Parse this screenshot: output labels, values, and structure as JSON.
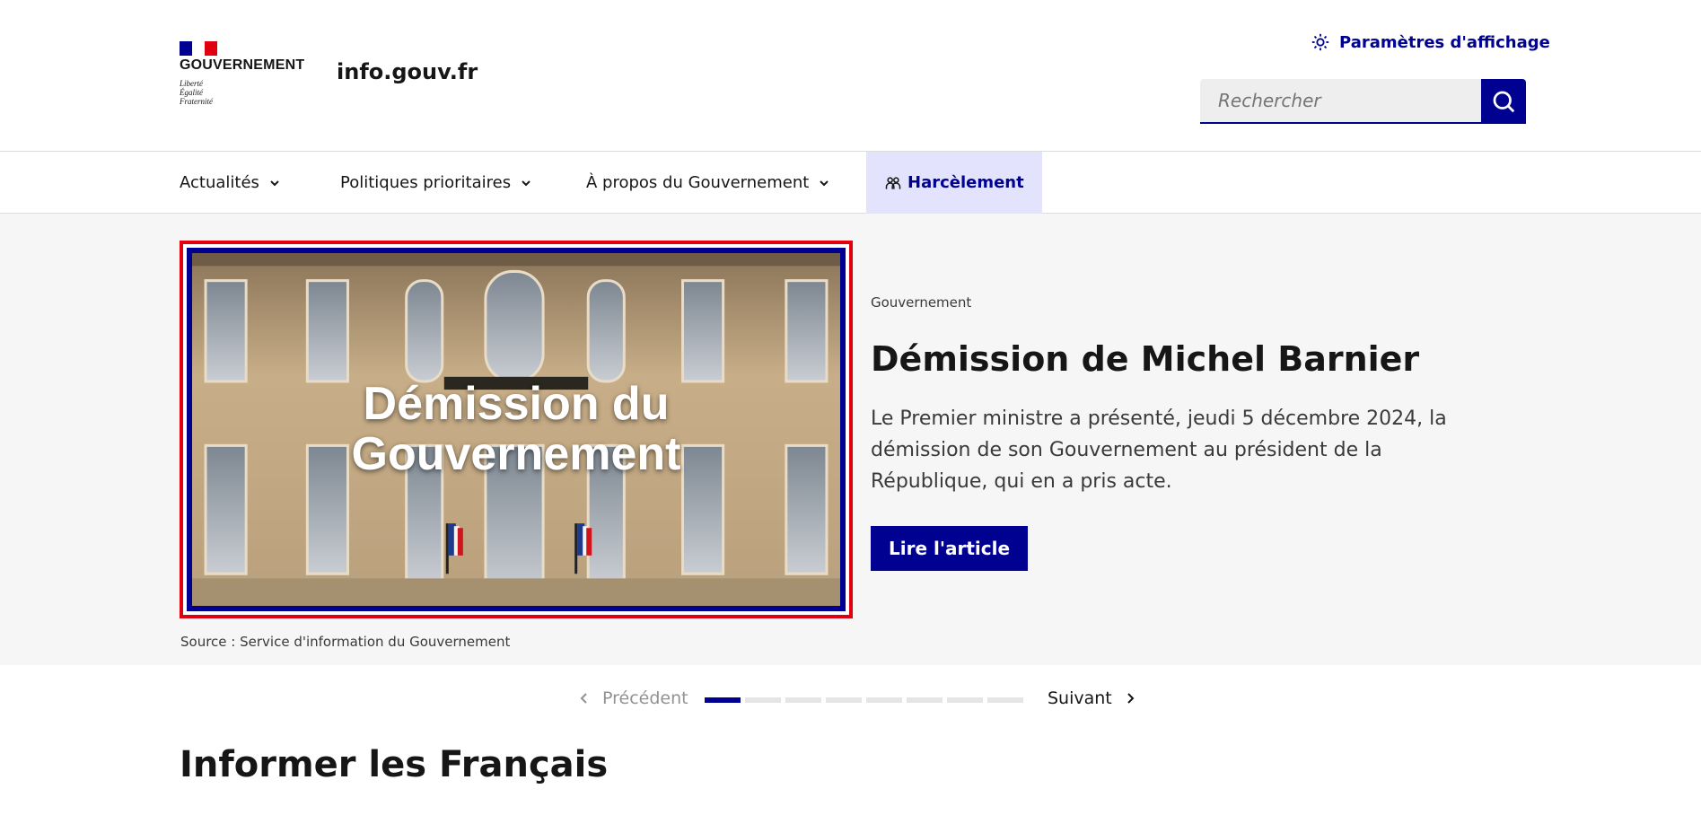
{
  "header": {
    "gov_label": "GOUVERNEMENT",
    "motto": [
      "Liberté",
      "Égalité",
      "Fraternité"
    ],
    "site_name": "info.gouv.fr",
    "display_settings_label": "Paramètres d'affichage",
    "search_placeholder": "Rechercher"
  },
  "nav": {
    "items": [
      {
        "label": "Actualités"
      },
      {
        "label": "Politiques prioritaires"
      },
      {
        "label": "À propos du Gouvernement"
      },
      {
        "label": "Harcèlement"
      }
    ]
  },
  "hero": {
    "image_title_line1": "Démission du",
    "image_title_line2": "Gouvernement",
    "source": "Source : Service d'information du Gouvernement",
    "tag": "Gouvernement",
    "headline": "Démission de Michel Barnier",
    "description": "Le Premier ministre a présenté, jeudi 5 décembre 2024, la démission de son Gouvernement au président de la République, qui en a pris acte.",
    "button_label": "Lire l'article"
  },
  "pager": {
    "prev_label": "Précédent",
    "next_label": "Suivant",
    "total_slides": 8,
    "active_slide": 1
  },
  "section": {
    "title": "Informer les Français"
  },
  "colors": {
    "primary": "#000091",
    "red": "#e1000f",
    "hero_bg": "#f6f6f6",
    "nav_highlight": "#e3e3fd"
  }
}
